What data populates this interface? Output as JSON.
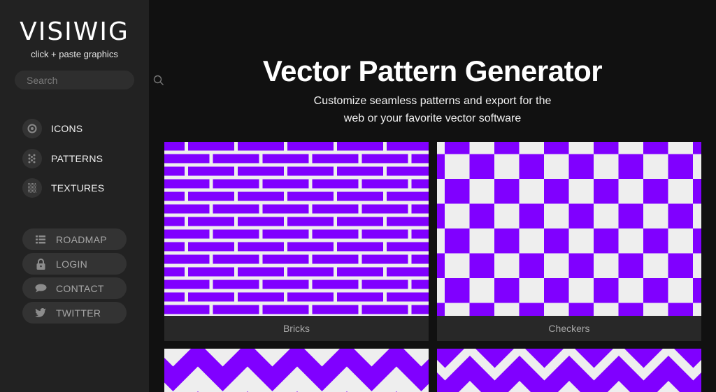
{
  "sidebar": {
    "logo": "VISIWIG",
    "tagline": "click + paste graphics",
    "search": {
      "placeholder": "Search",
      "value": "",
      "icon": "search-icon"
    },
    "nav": [
      {
        "label": "ICONS",
        "icon": "target-icon"
      },
      {
        "label": "PATTERNS",
        "icon": "dots-grid-icon"
      },
      {
        "label": "TEXTURES",
        "icon": "texture-icon"
      }
    ],
    "links": [
      {
        "label": "ROADMAP",
        "icon": "list-icon"
      },
      {
        "label": "LOGIN",
        "icon": "lock-icon"
      },
      {
        "label": "CONTACT",
        "icon": "speech-bubble-icon"
      },
      {
        "label": "TWITTER",
        "icon": "twitter-bird-icon"
      }
    ]
  },
  "main": {
    "title": "Vector Pattern Generator",
    "subtitle_line1": "Customize seamless patterns and export for the",
    "subtitle_line2": "web or your favorite vector software",
    "patterns": [
      {
        "name": "Bricks",
        "kind": "bricks"
      },
      {
        "name": "Checkers",
        "kind": "checkers"
      },
      {
        "name": "",
        "kind": "herringbone-chevron"
      },
      {
        "name": "",
        "kind": "zigzag"
      }
    ]
  },
  "colors": {
    "accent": "#8000ff",
    "pattern_light": "#eeeeee",
    "sidebar_bg": "#222222",
    "page_bg": "#111111",
    "card_label_bg": "#282828"
  }
}
